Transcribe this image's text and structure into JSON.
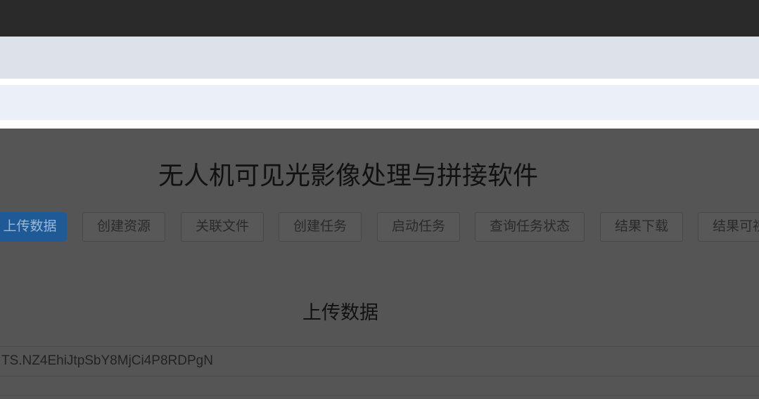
{
  "app": {
    "title": "无人机可见光影像处理与拼接软件"
  },
  "nav": {
    "items": [
      {
        "label": "上传数据",
        "active": true
      },
      {
        "label": "创建资源",
        "active": false
      },
      {
        "label": "关联文件",
        "active": false
      },
      {
        "label": "创建任务",
        "active": false
      },
      {
        "label": "启动任务",
        "active": false
      },
      {
        "label": "查询任务状态",
        "active": false
      },
      {
        "label": "结果下载",
        "active": false
      },
      {
        "label": "结果可视",
        "active": false
      }
    ]
  },
  "section": {
    "title": "上传数据",
    "token": "TS.NZ4EhiJtpSbY8MjCi4P8RDPgN"
  },
  "colors": {
    "accent": "#1f5a96",
    "overlay": "#555555",
    "topbar": "#2a2a2a"
  }
}
